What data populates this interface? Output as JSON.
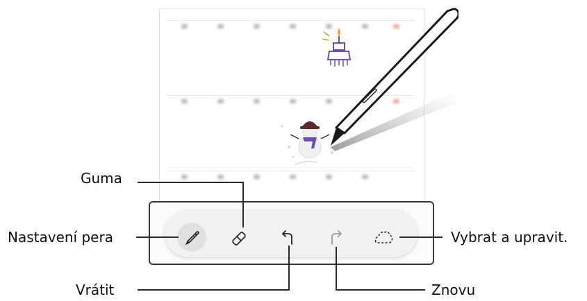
{
  "callouts": {
    "guma": "Guma",
    "nastaveni_pera": "Nastavení pera",
    "vratit": "Vrátit",
    "znovu": "Znovu",
    "vybrat": "Vybrat a upravit."
  },
  "toolbar": {
    "buttons": [
      {
        "id": "pen-settings",
        "icon": "pen-icon",
        "active": true
      },
      {
        "id": "eraser",
        "icon": "eraser-icon",
        "active": false
      },
      {
        "id": "undo",
        "icon": "undo-arrow-icon",
        "active": false
      },
      {
        "id": "redo",
        "icon": "redo-arrow-icon",
        "active": false
      },
      {
        "id": "lasso-select",
        "icon": "lasso-icon",
        "active": false
      }
    ]
  },
  "colors": {
    "line": "#3a3a3a",
    "pen_body": "#ffffff",
    "snowman_hat": "#5a2a2a",
    "snowman_scarf": "#6b4fb0",
    "cake": "#6b4fb0",
    "candle_flame": "#f2a23a"
  }
}
